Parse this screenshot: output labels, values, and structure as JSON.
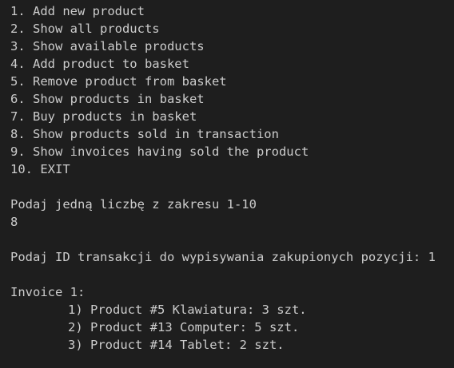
{
  "terminal": {
    "menu": [
      "1. Add new product",
      "2. Show all products",
      "3. Show available products",
      "4. Add product to basket",
      "5. Remove product from basket",
      "6. Show products in basket",
      "7. Buy products in basket",
      "8. Show products sold in transaction",
      "9. Show invoices having sold the product",
      "10. EXIT"
    ],
    "prompt_choice": "Podaj jedną liczbę z zakresu 1-10",
    "user_choice": "8",
    "prompt_transaction": "Podaj ID transakcji do wypisywania zakupionych pozycji: 1",
    "invoice_header": "Invoice 1:",
    "invoice_items": [
      "1) Product #5 Klawiatura: 3 szt.",
      "2) Product #13 Computer: 5 szt.",
      "3) Product #14 Tablet: 2 szt."
    ]
  }
}
